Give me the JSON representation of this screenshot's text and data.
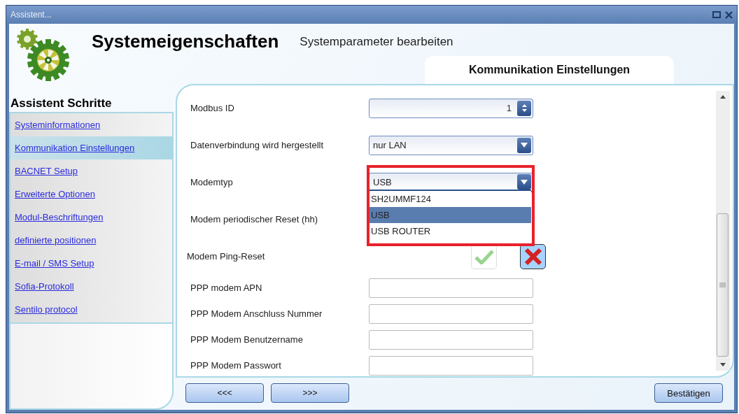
{
  "window": {
    "title": "Assistent..."
  },
  "header": {
    "title": "Systemeigenschaften",
    "subtitle": "Systemparameter bearbeiten",
    "tab": "Kommunikation Einstellungen"
  },
  "sidebar": {
    "heading": "Assistent Schritte",
    "items": [
      {
        "label": "Systeminformationen",
        "selected": false
      },
      {
        "label": "Kommunikation Einstellungen",
        "selected": true
      },
      {
        "label": "BACNET Setup",
        "selected": false
      },
      {
        "label": "Erweiterte Optionen",
        "selected": false
      },
      {
        "label": "Modul-Beschriftungen",
        "selected": false
      },
      {
        "label": "definierte positionen",
        "selected": false
      },
      {
        "label": "E-mail / SMS Setup",
        "selected": false
      },
      {
        "label": "Sofia-Protokoll",
        "selected": false
      },
      {
        "label": "Sentilo protocol",
        "selected": false
      }
    ]
  },
  "form": [
    {
      "kind": "spinner",
      "label": "Modbus ID",
      "value": "1"
    },
    {
      "kind": "dropdown",
      "label": "Datenverbindung wird hergestellt",
      "value": "nur LAN",
      "expanded": false
    },
    {
      "kind": "dropdown",
      "label": "Modemtyp",
      "value": "USB",
      "expanded": true,
      "highlighted": true,
      "options": [
        {
          "label": "SH2UMMF124",
          "selected": false
        },
        {
          "label": "USB",
          "selected": true
        },
        {
          "label": "USB ROUTER",
          "selected": false
        }
      ]
    },
    {
      "kind": "covered",
      "label": "Modem periodischer Reset (hh)"
    },
    {
      "kind": "toggle",
      "label": "Modem Ping-Reset",
      "on": false
    },
    {
      "kind": "text",
      "label": "PPP modem APN"
    },
    {
      "kind": "text",
      "label": "PPP Modem Anschluss Nummer"
    },
    {
      "kind": "text",
      "label": "PPP Modem Benutzername"
    },
    {
      "kind": "text",
      "label": "PPP Modem Passwort"
    }
  ],
  "buttons": [
    {
      "kind": "back",
      "label": "<<<"
    },
    {
      "kind": "next",
      "label": ">>>"
    },
    {
      "kind": "confirm",
      "label": "Bestätigen"
    }
  ]
}
